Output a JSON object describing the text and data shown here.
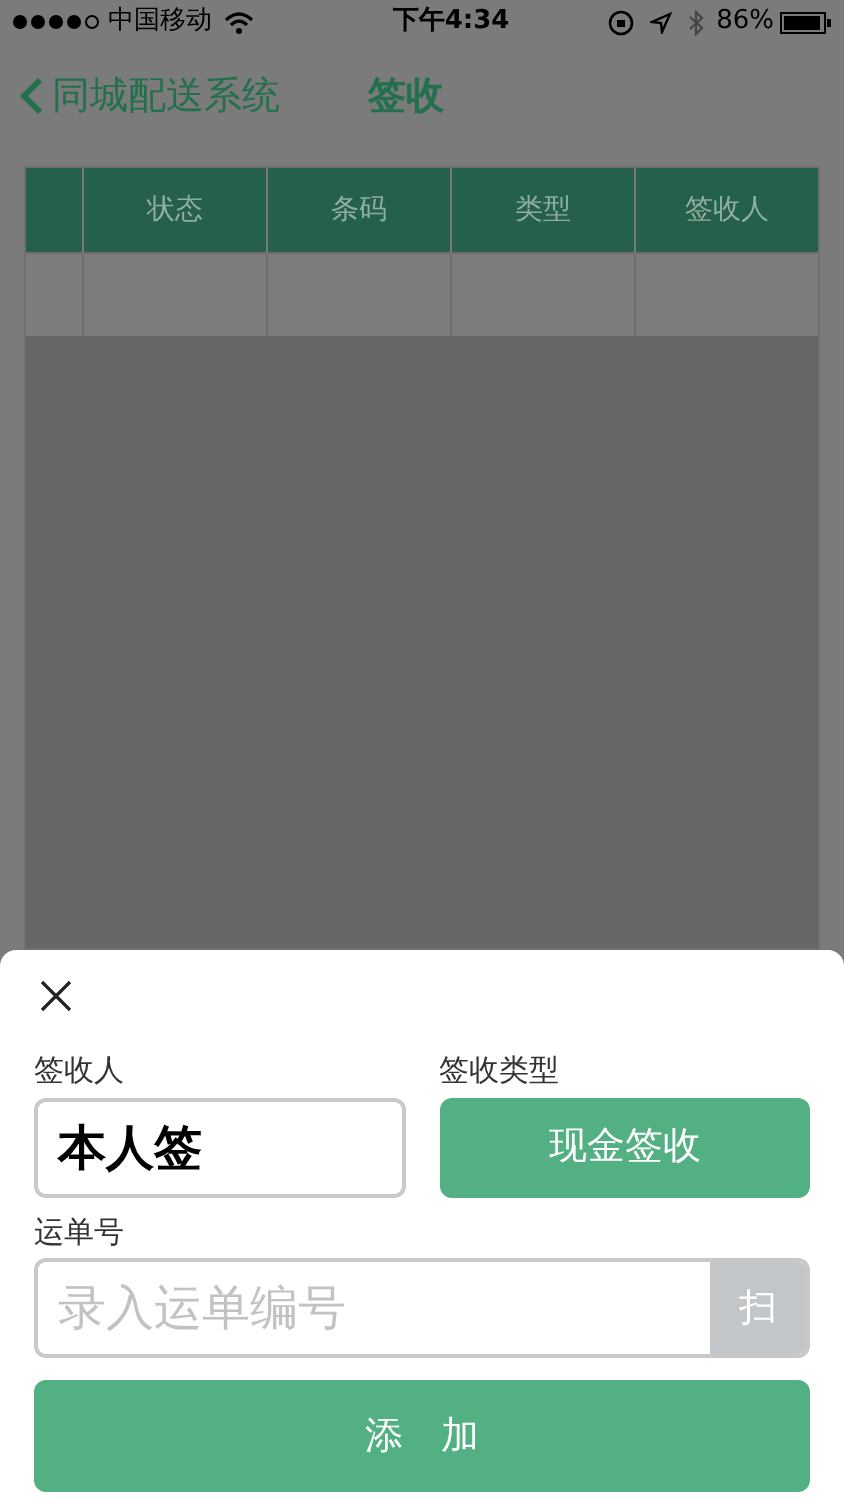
{
  "status_bar": {
    "carrier": "中国移动",
    "time": "下午4:34",
    "battery": "86%"
  },
  "nav": {
    "back_label": "同城配送系统",
    "title": "签收"
  },
  "table": {
    "columns": [
      "状态",
      "条码",
      "类型",
      "签收人"
    ]
  },
  "sheet": {
    "receiver_label": "签收人",
    "receiver_value": "本人签",
    "type_label": "签收类型",
    "type_button": "现金签收",
    "waybill_label": "运单号",
    "waybill_placeholder": "录入运单编号",
    "scan_button": "扫",
    "add_button": "添　加"
  }
}
